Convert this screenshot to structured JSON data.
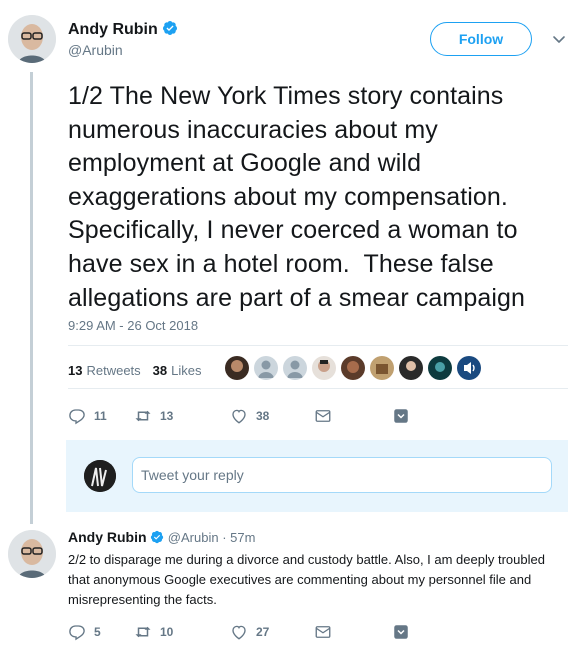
{
  "main_tweet": {
    "author_name": "Andy Rubin",
    "author_handle": "@Arubin",
    "follow_label": "Follow",
    "text": "1/2 The New York Times story contains numerous inaccuracies about my employment at Google and wild exaggerations about my compensation. Specifically, I never coerced a woman to have sex in a hotel room.  These false allegations are part of a smear campaign",
    "timestamp": "9:29 AM - 26 Oct 2018",
    "retweets_count": "13",
    "retweets_label": "Retweets",
    "likes_count": "38",
    "likes_label": "Likes",
    "actions": {
      "replies": "11",
      "retweets": "13",
      "likes": "38"
    }
  },
  "reply_box": {
    "placeholder": "Tweet your reply"
  },
  "second_tweet": {
    "author_name": "Andy Rubin",
    "author_handle": "@Arubin",
    "time": "· 57m",
    "text": "2/2 to disparage me during a divorce and custody battle. Also, I am deeply troubled that anonymous Google executives are commenting about my personnel file and misrepresenting the facts.",
    "actions": {
      "replies": "5",
      "retweets": "10",
      "likes": "27"
    }
  },
  "colors": {
    "accent": "#1da1f2",
    "muted": "#657786",
    "text": "#14171a"
  }
}
